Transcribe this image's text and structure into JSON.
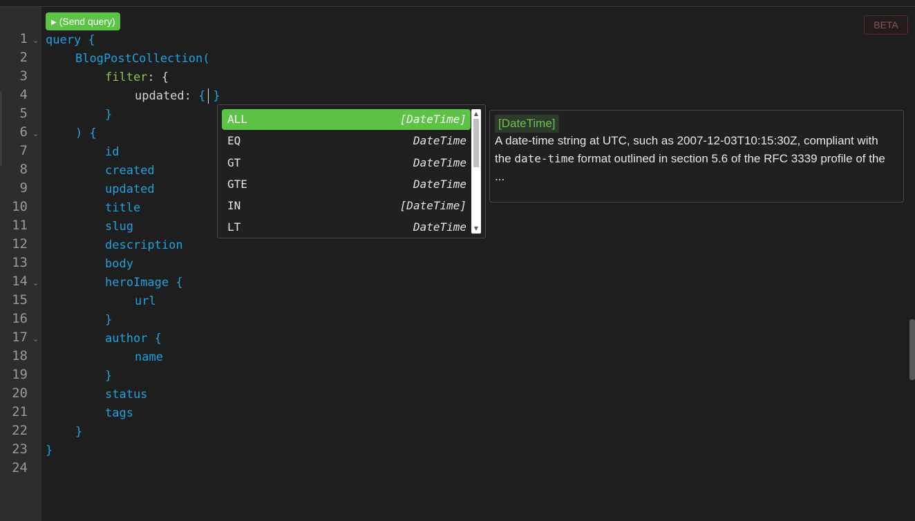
{
  "toolbar": {
    "send_button_label": "(Send query)",
    "send_button_icon": "play-icon",
    "beta_badge": "BETA"
  },
  "editor": {
    "line_numbers": [
      "1",
      "2",
      "3",
      "4",
      "5",
      "6",
      "7",
      "8",
      "9",
      "10",
      "11",
      "12",
      "13",
      "14",
      "15",
      "16",
      "17",
      "18",
      "19",
      "20",
      "21",
      "22",
      "23",
      "24"
    ],
    "lines": {
      "l1_kw": "query",
      "l1_brace": " {",
      "l2_fn": "BlogPostCollection",
      "l2_paren": "(",
      "l3_arg": "filter",
      "l3_rest": ": {",
      "l4_field": "updated: ",
      "l4_open": "{",
      "l4_close": "}",
      "l5": "}",
      "l6": ") {",
      "l7": "id",
      "l8": "created",
      "l9": "updated",
      "l10": "title",
      "l11": "slug",
      "l12": "description",
      "l13": "body",
      "l14": "heroImage {",
      "l15": "url",
      "l16": "}",
      "l17": "author {",
      "l18": "name",
      "l19": "}",
      "l20": "status",
      "l21": "tags",
      "l22": "}",
      "l23": "}"
    }
  },
  "autocomplete": {
    "items": [
      {
        "name": "ALL",
        "type": "[DateTime]",
        "selected": true
      },
      {
        "name": "EQ",
        "type": "DateTime",
        "selected": false
      },
      {
        "name": "GT",
        "type": "DateTime",
        "selected": false
      },
      {
        "name": "GTE",
        "type": "DateTime",
        "selected": false
      },
      {
        "name": "IN",
        "type": "[DateTime]",
        "selected": false
      },
      {
        "name": "LT",
        "type": "DateTime",
        "selected": false
      }
    ]
  },
  "info": {
    "type_tag": "[DateTime]",
    "text_part1": "A date-time string at UTC, such as 2007-12-03T10:15:30Z, compliant with the ",
    "text_code": "date-time",
    "text_part2": " format outlined in section 5.6 of the RFC 3339 profile of the ..."
  },
  "colors": {
    "accent_green": "#5cc346",
    "keyword_blue": "#1fa3e0",
    "argument_green": "#8bc34a",
    "background": "#1e1e1e"
  }
}
